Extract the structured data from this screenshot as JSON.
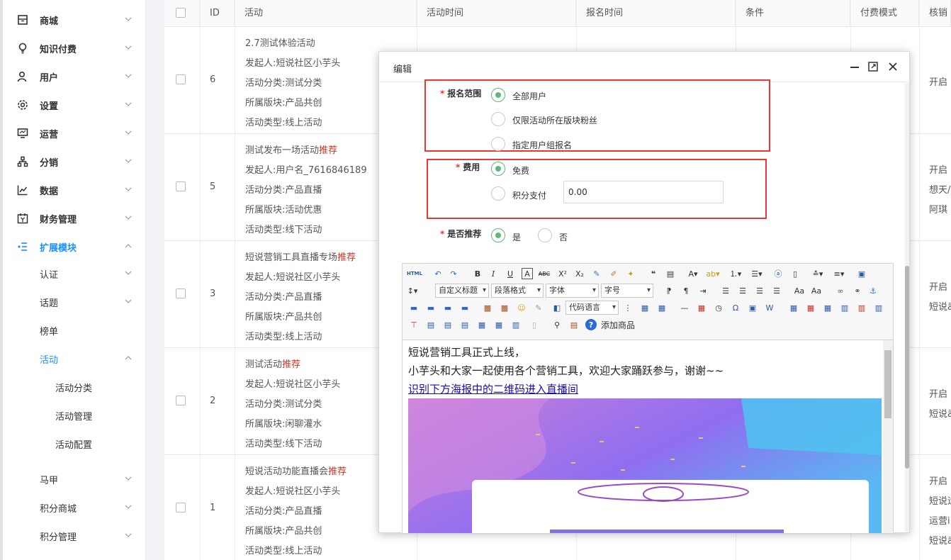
{
  "sidebar": {
    "items": [
      {
        "label": "商城",
        "icon": "store-icon"
      },
      {
        "label": "知识付费",
        "icon": "bulb-icon"
      },
      {
        "label": "用户",
        "icon": "user-icon"
      },
      {
        "label": "设置",
        "icon": "gear-icon"
      },
      {
        "label": "运营",
        "icon": "monitor-icon"
      },
      {
        "label": "分销",
        "icon": "org-chart-icon"
      },
      {
        "label": "数据",
        "icon": "line-chart-icon"
      },
      {
        "label": "财务管理",
        "icon": "calendar-money-icon"
      },
      {
        "label": "扩展模块",
        "icon": "extension-icon"
      }
    ],
    "sub_items": [
      "认证",
      "话题",
      "榜单",
      "活动"
    ],
    "activity_children": [
      "活动分类",
      "活动管理",
      "活动配置"
    ],
    "bottom_items": [
      "马甲",
      "积分商城",
      "积分管理"
    ]
  },
  "table": {
    "columns": [
      "ID",
      "活动",
      "活动时间",
      "报名时间",
      "条件",
      "付费模式",
      "核销"
    ],
    "rows": [
      {
        "id": "6",
        "title": "2.7测试体验活动",
        "tag": "",
        "initiator": "发起人:短说社区小芋头",
        "category": "活动分类:测试分类",
        "block": "所属版块:产品共创",
        "type": "活动类型:线上活动",
        "right": [
          "开启"
        ]
      },
      {
        "id": "5",
        "title": "测试发布一场活动",
        "tag": "推荐",
        "initiator": "发起人:用户名_7616846189",
        "category": "活动分类:产品直播",
        "block": "所属版块:活动优惠",
        "type": "活动类型:线下活动",
        "right": [
          "开启",
          "想天/",
          "阿琪"
        ]
      },
      {
        "id": "3",
        "title": "短说营销工具直播专场",
        "tag": "推荐",
        "initiator": "发起人:短说社区小芋头",
        "category": "活动分类:产品直播",
        "block": "所属版块:产品共创",
        "type": "活动类型:线上活动",
        "right": [
          "开启",
          "短说ä"
        ]
      },
      {
        "id": "2",
        "title": "测试活动",
        "tag": "推荐",
        "initiator": "发起人:短说社区小芋头",
        "category": "活动分类:测试分类",
        "block": "所属版块:闲聊灌水",
        "type": "活动类型:线下活动",
        "right": [
          "开启",
          "短说ä"
        ]
      },
      {
        "id": "1",
        "title": "短说活动功能直播会",
        "tag": "推荐",
        "initiator": "发起人:短说社区小芋头",
        "category": "活动分类:产品直播",
        "block": "所属版块:产品共创",
        "type": "活动类型:线上活动",
        "right": [
          "开启",
          "短说运",
          "运营i",
          "短说ä"
        ]
      }
    ]
  },
  "modal": {
    "title": "编辑",
    "scope_label": "报名范围",
    "scope_options": [
      "全部用户",
      "仅限活动所在版块粉丝",
      "指定用户组报名"
    ],
    "fee_label": "费用",
    "fee_options": [
      "免费",
      "积分支付"
    ],
    "points_value": "0.00",
    "recommend_label": "是否推荐",
    "recommend_options": [
      "是",
      "否"
    ],
    "required_mark": "*",
    "colors": {
      "radio_on": "#5fb878",
      "highlight": "#e53935",
      "link": "#1a0dab"
    }
  },
  "editor": {
    "toolbar_selects": [
      "自定义标题",
      "段落格式",
      "字体",
      "字号",
      "代码语言"
    ],
    "add_product_label": "添加商品",
    "html_label": "HTML",
    "content_lines": [
      "短说营销工具正式上线，",
      "小芋头和大家一起使用各个营销工具，欢迎大家踊跃参与，谢谢~~"
    ],
    "content_link": "识别下方海报中的二维码进入直播间"
  }
}
